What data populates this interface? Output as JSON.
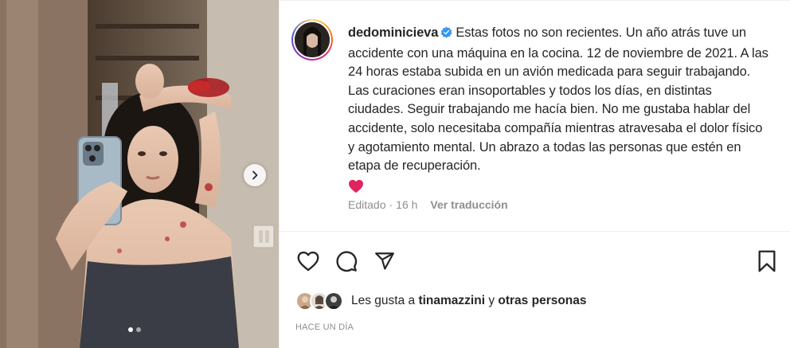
{
  "post": {
    "username": "dedominicieva",
    "verified": true,
    "caption": "Estas fotos no son recientes. Un año atrás tuve un accidente con una máquina en la cocina. 12 de noviembre de 2021. A las 24 horas estaba subida en un avión medicada para seguir trabajando. Las curaciones eran insoportables y todos los días, en distintas ciudades. Seguir trabajando me hacía bien. No me gustaba hablar del accidente, solo necesitaba compañía mientras atravesaba el dolor físico y agotamiento mental. Un abrazo a todas las personas que estén en etapa de recuperación.",
    "caption_emoji": "red-heart-icon",
    "edited_label": "Editado",
    "separator": "·",
    "time_ago": "16 h",
    "translate_label": "Ver traducción",
    "likes": {
      "prefix": "Les gusta a",
      "first_user": "tinamazzini",
      "conjunction": "y",
      "others": "otras personas"
    },
    "date_label": "HACE UN DÍA",
    "carousel": {
      "slide_count": 2,
      "active_index": 0
    }
  },
  "icons": {
    "like": "heart-outline-icon",
    "comment": "comment-bubble-icon",
    "share": "paper-plane-icon",
    "save": "bookmark-icon",
    "next": "chevron-right-icon"
  },
  "colors": {
    "verified": "#3897f0",
    "heart": "#ed4956",
    "text": "#262626",
    "muted": "#8e8e8e"
  }
}
